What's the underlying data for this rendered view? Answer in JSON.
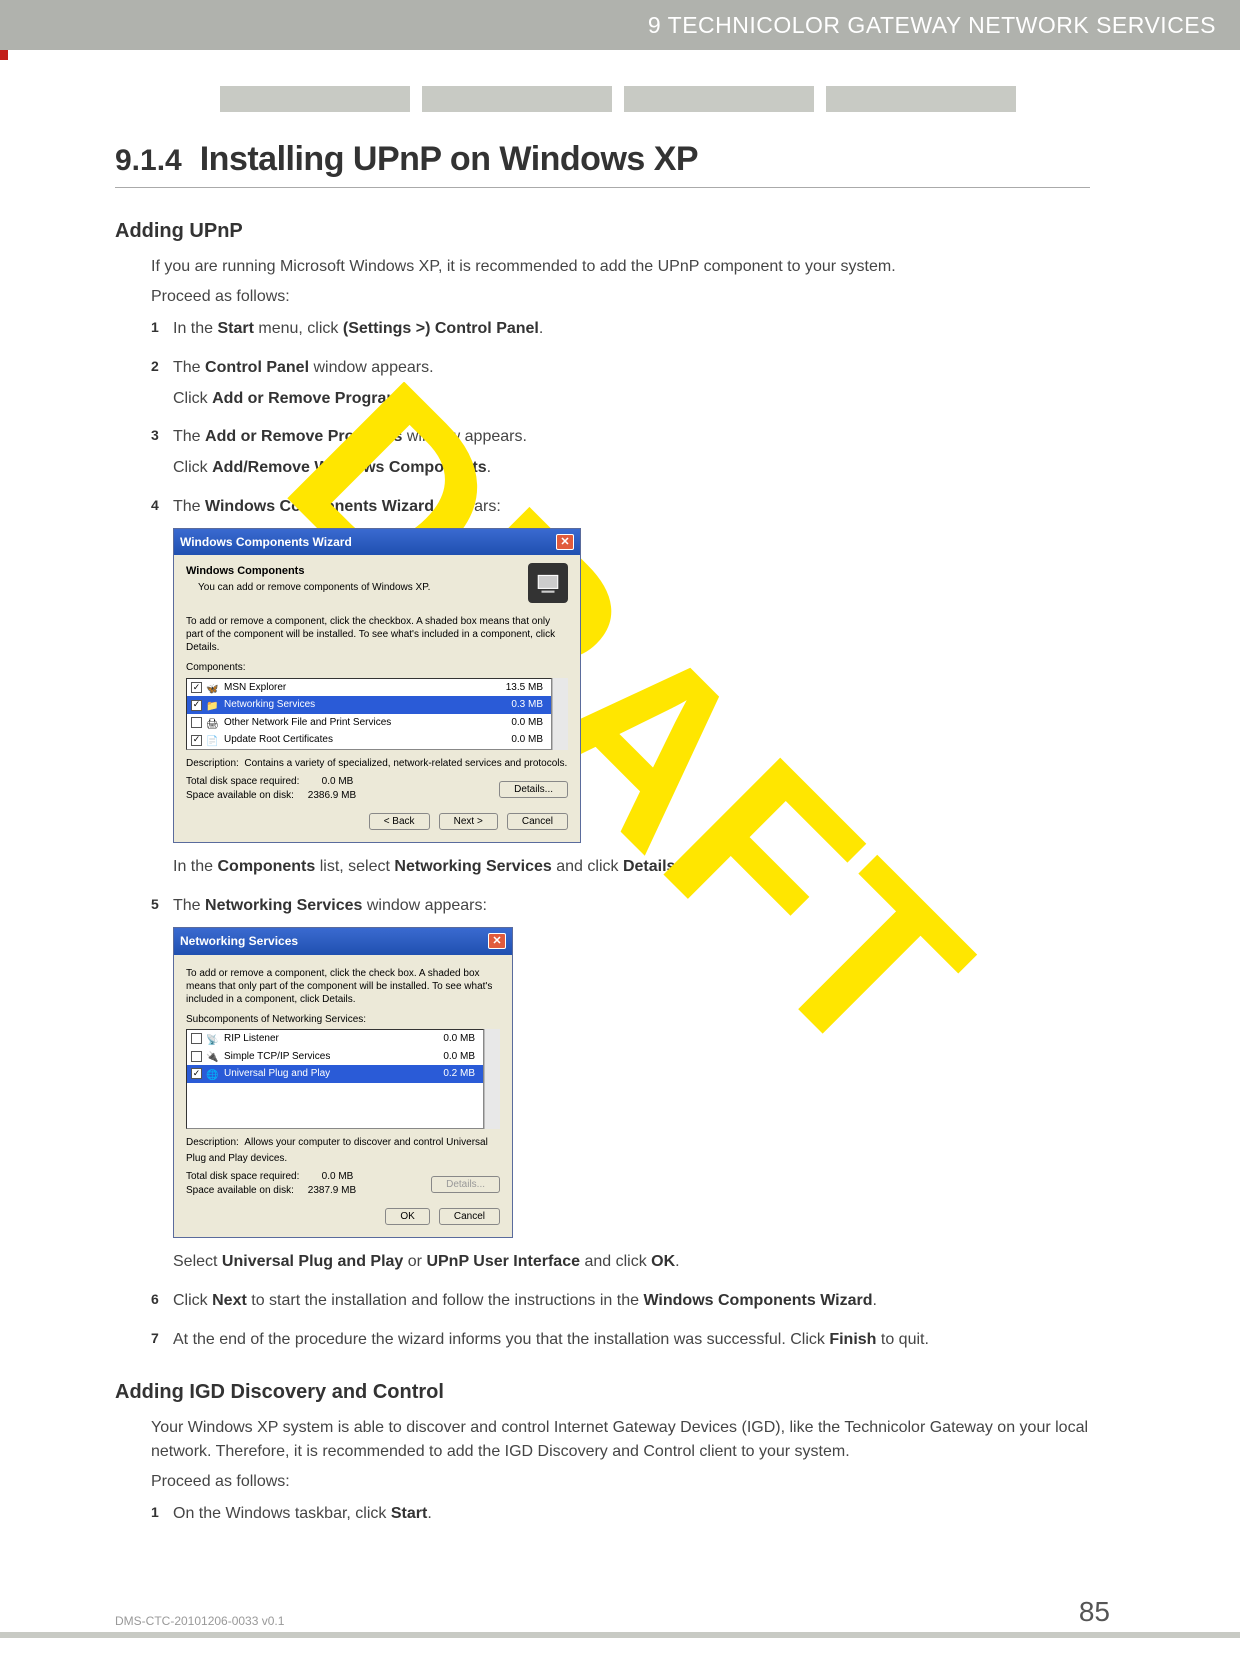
{
  "header": {
    "chapter_label": "9 TECHNICOLOR GATEWAY NETWORK SERVICES"
  },
  "section": {
    "number": "9.1.4",
    "title": "Installing UPnP on Windows XP"
  },
  "adding_upnp": {
    "heading": "Adding UPnP",
    "intro1": "If you are running Microsoft Windows XP, it is recommended to add the UPnP component to your system.",
    "intro2": "Proceed as follows:",
    "steps": {
      "s1_pre": "In the ",
      "s1_b1": "Start",
      "s1_mid1": " menu, click ",
      "s1_b2": "(Settings >) Control Panel",
      "s1_end": ".",
      "s2_pre": "The ",
      "s2_b1": "Control Panel",
      "s2_mid": " window appears.",
      "s2_line2_pre": "Click ",
      "s2_line2_b": "Add or Remove Programs",
      "s2_line2_end": ".",
      "s3_pre": "The ",
      "s3_b1": "Add or Remove Programs",
      "s3_mid": " window appears.",
      "s3_line2_pre": "Click ",
      "s3_line2_b": "Add/Remove Windows Components",
      "s3_line2_end": ".",
      "s4_pre": "The ",
      "s4_b1": "Windows Components Wizard",
      "s4_end": " appears:",
      "s4_after_pre": "In the ",
      "s4_after_b1": "Components",
      "s4_after_mid1": " list, select ",
      "s4_after_b2": "Networking Services",
      "s4_after_mid2": " and click ",
      "s4_after_b3": "Details",
      "s5_pre": "The ",
      "s5_b1": "Networking Services",
      "s5_end": " window appears:",
      "s5_after_pre": "Select ",
      "s5_after_b1": "Universal Plug and Play",
      "s5_after_mid1": " or ",
      "s5_after_b2": "UPnP User Interface",
      "s5_after_mid2": " and click ",
      "s5_after_b3": "OK",
      "s5_after_end": ".",
      "s6_pre": "Click ",
      "s6_b1": "Next",
      "s6_mid": " to start the installation and follow the instructions in the ",
      "s6_b2": "Windows Components Wizard",
      "s6_end": ".",
      "s7_pre": "At the end of the procedure the wizard informs you that the installation was successful. Click ",
      "s7_b1": "Finish",
      "s7_end": " to quit."
    }
  },
  "dialog1": {
    "title": "Windows Components Wizard",
    "h_bold": "Windows Components",
    "h_sub": "You can add or remove components of Windows XP.",
    "instr": "To add or remove a component, click the checkbox. A shaded box means that only part of the component will be installed. To see what's included in a component, click Details.",
    "list_label": "Components:",
    "rows": [
      {
        "checked": true,
        "name": "MSN Explorer",
        "size": "13.5 MB"
      },
      {
        "checked": true,
        "name": "Networking Services",
        "size": "0.3 MB",
        "selected": true
      },
      {
        "checked": false,
        "name": "Other Network File and Print Services",
        "size": "0.0 MB"
      },
      {
        "checked": true,
        "name": "Update Root Certificates",
        "size": "0.0 MB"
      }
    ],
    "desc_label": "Description:",
    "desc_text": "Contains a variety of specialized, network-related services and protocols.",
    "disk_req_label": "Total disk space required:",
    "disk_req_val": "0.0 MB",
    "disk_avail_label": "Space available on disk:",
    "disk_avail_val": "2386.9 MB",
    "btn_details": "Details...",
    "btn_back": "< Back",
    "btn_next": "Next >",
    "btn_cancel": "Cancel"
  },
  "dialog2": {
    "title": "Networking Services",
    "instr": "To add or remove a component, click the check box. A shaded box means that only part of the component will be installed. To see what's included in a component, click Details.",
    "list_label": "Subcomponents of Networking Services:",
    "rows": [
      {
        "checked": false,
        "name": "RIP Listener",
        "size": "0.0 MB"
      },
      {
        "checked": false,
        "name": "Simple TCP/IP Services",
        "size": "0.0 MB"
      },
      {
        "checked": true,
        "name": "Universal Plug and Play",
        "size": "0.2 MB",
        "selected": true
      }
    ],
    "desc_label": "Description:",
    "desc_text": "Allows your computer to discover and control Universal Plug and Play devices.",
    "disk_req_label": "Total disk space required:",
    "disk_req_val": "0.0 MB",
    "disk_avail_label": "Space available on disk:",
    "disk_avail_val": "2387.9 MB",
    "btn_details": "Details...",
    "btn_ok": "OK",
    "btn_cancel": "Cancel"
  },
  "adding_igd": {
    "heading": "Adding IGD Discovery and Control",
    "intro1": "Your Windows XP system is able to discover and control Internet Gateway Devices (IGD), like the Technicolor Gateway on your local network. Therefore, it is recommended to add the IGD Discovery and Control client to your system.",
    "intro2": "Proceed as follows:",
    "s1_pre": "On the Windows taskbar, click ",
    "s1_b1": "Start",
    "s1_end": "."
  },
  "footer": {
    "doc_id": "DMS-CTC-20101206-0033 v0.1",
    "page_num": "85"
  },
  "watermark": "DRAFT"
}
